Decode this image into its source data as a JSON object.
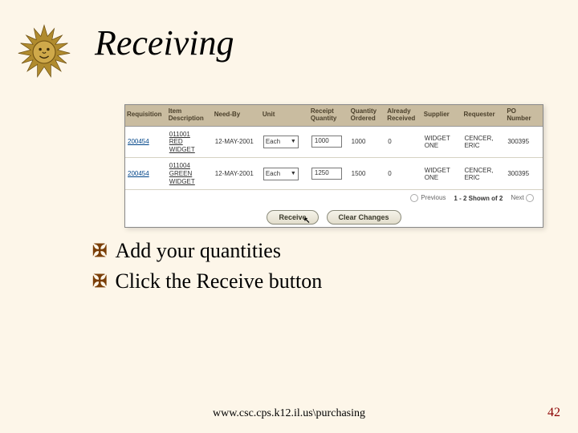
{
  "title": "Receiving",
  "icons": {
    "decorative_sun": "sun-icon"
  },
  "table": {
    "headers": [
      "Requisition",
      "Item Description",
      "Need-By",
      "Unit",
      "Receipt Quantity",
      "Quantity Ordered",
      "Already Received",
      "Supplier",
      "Requester",
      "PO Number"
    ],
    "rows": [
      {
        "requisition": "200454",
        "item_code": "011001",
        "item_name": "RED WIDGET",
        "need_by": "12-MAY-2001",
        "unit": "Each",
        "receipt_qty": "1000",
        "qty_ordered": "1000",
        "already_received": "0",
        "supplier": "WIDGET ONE",
        "requester": "CENCER, ERIC",
        "po_number": "300395"
      },
      {
        "requisition": "200454",
        "item_code": "011004",
        "item_name": "GREEN WIDGET",
        "need_by": "12-MAY-2001",
        "unit": "Each",
        "receipt_qty": "1250",
        "qty_ordered": "1500",
        "already_received": "0",
        "supplier": "WIDGET ONE",
        "requester": "CENCER, ERIC",
        "po_number": "300395"
      }
    ]
  },
  "pager": {
    "previous": "Previous",
    "shown": "1 - 2 Shown of 2",
    "next": "Next"
  },
  "buttons": {
    "receive": "Receive",
    "clear": "Clear Changes"
  },
  "bullets": [
    "Add your quantities",
    "Click the Receive button"
  ],
  "footer_url": "www.csc.cps.k12.il.us\\purchasing",
  "page_number": "42"
}
